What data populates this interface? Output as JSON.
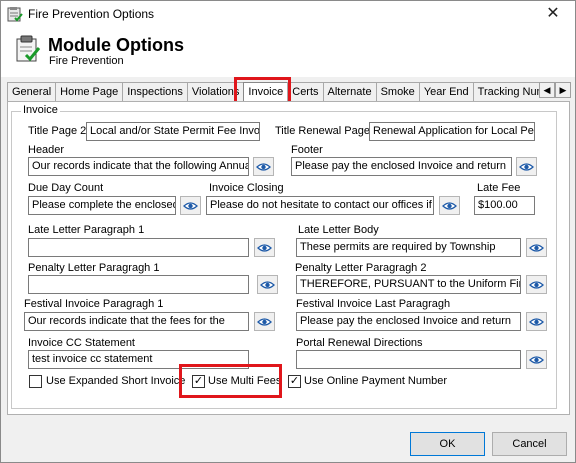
{
  "window": {
    "title": "Fire Prevention Options",
    "close_glyph": "✕"
  },
  "header": {
    "title": "Module Options",
    "subtitle": "Fire Prevention"
  },
  "tabs": [
    "General",
    "Home Page",
    "Inspections",
    "Violations",
    "Invoice",
    "Certs",
    "Alternate",
    "Smoke",
    "Year End",
    "Tracking Num"
  ],
  "active_tab": "Invoice",
  "group": {
    "label": "Invoice"
  },
  "fields": {
    "title_page_2": {
      "label": "Title Page 2",
      "value": "Local and/or State Permit Fee Invoic"
    },
    "title_renewal_page": {
      "label": "Title Renewal Page",
      "value": "Renewal Application for Local Perm"
    },
    "header": {
      "label": "Header",
      "value": "Our records indicate that the following Annual"
    },
    "footer": {
      "label": "Footer",
      "value": "Please pay the enclosed Invoice and return"
    },
    "due_day_count": {
      "label": "Due Day Count",
      "value": "Please complete the enclosed A"
    },
    "invoice_closing": {
      "label": "Invoice Closing",
      "value": "Please do not hesitate to contact our offices if"
    },
    "late_fee": {
      "label": "Late Fee",
      "value": "$100.00"
    },
    "late_letter_paragraph_1": {
      "label": "Late Letter Paragraph 1",
      "value": ""
    },
    "late_letter_body": {
      "label": "Late Letter Body",
      "value": "These permits are required by Township"
    },
    "penalty_letter_paragraph_1": {
      "label": "Penalty Letter Paragragh 1",
      "value": ""
    },
    "penalty_letter_paragraph_2": {
      "label": "Penalty Letter Paragragh 2",
      "value": "THEREFORE, PURSUANT to the Uniform Fire"
    },
    "festival_invoice_paragraph_1": {
      "label": "Festival Invoice Paragragh 1",
      "value": "Our records indicate that the fees for the"
    },
    "festival_invoice_last_paragraph": {
      "label": "Festival Invoice Last Paragragh",
      "value": "Please pay the enclosed Invoice and return"
    },
    "invoice_cc_statement": {
      "label": "Invoice CC Statement",
      "value": "test invoice cc statement"
    },
    "portal_renewal_directions": {
      "label": "Portal Renewal Directions",
      "value": ""
    }
  },
  "checkboxes": {
    "use_expanded_short_invoice": {
      "label": "Use Expanded Short Invoice",
      "checked": false
    },
    "use_multi_fees": {
      "label": "Use Multi Fees",
      "checked": true
    },
    "use_online_payment_number": {
      "label": "Use Online Payment Number",
      "checked": true
    }
  },
  "buttons": {
    "ok": "OK",
    "cancel": "Cancel"
  },
  "colors": {
    "highlight": "#e0161b",
    "eye_icon": "#1e5aa8",
    "focus_border": "#0078d7"
  }
}
